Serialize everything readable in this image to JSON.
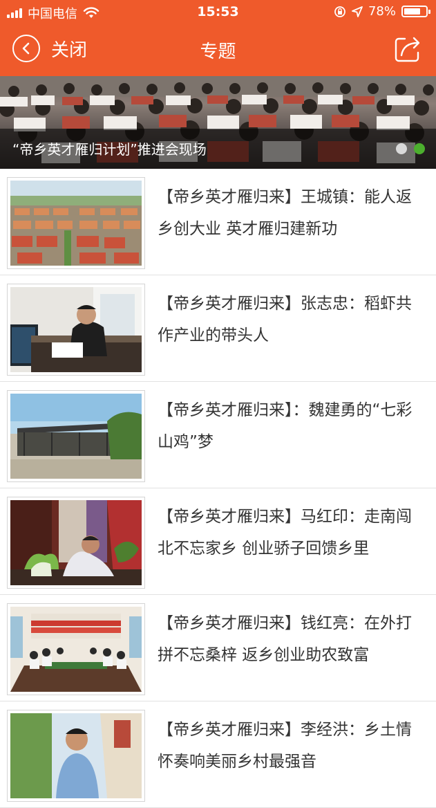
{
  "status_bar": {
    "carrier": "中国电信",
    "time": "15:53",
    "battery": "78%",
    "battery_level": 0.78
  },
  "nav": {
    "back_label": "关闭",
    "title": "专题"
  },
  "banner": {
    "caption": "“帝乡英才雁归计划”推进会现场",
    "slide_count": 2,
    "active_slide": 2
  },
  "articles": [
    {
      "title": "【帝乡英才雁归来】王城镇：能人返乡创大业 英才雁归建新功"
    },
    {
      "title": "【帝乡英才雁归来】张志忠：稻虾共作产业的带头人"
    },
    {
      "title": "【帝乡英才雁归来】：魏建勇的“七彩山鸡”梦"
    },
    {
      "title": "【帝乡英才雁归来】马红印：走南闯北不忘家乡 创业骄子回馈乡里"
    },
    {
      "title": "【帝乡英才雁归来】钱红亮：在外打拼不忘桑梓 返乡创业助农致富"
    },
    {
      "title": "【帝乡英才雁归来】李经洪：乡土情怀奏响美丽乡村最强音"
    }
  ],
  "colors": {
    "accent": "#ef5a2b",
    "active_dot": "#4caf2e"
  }
}
